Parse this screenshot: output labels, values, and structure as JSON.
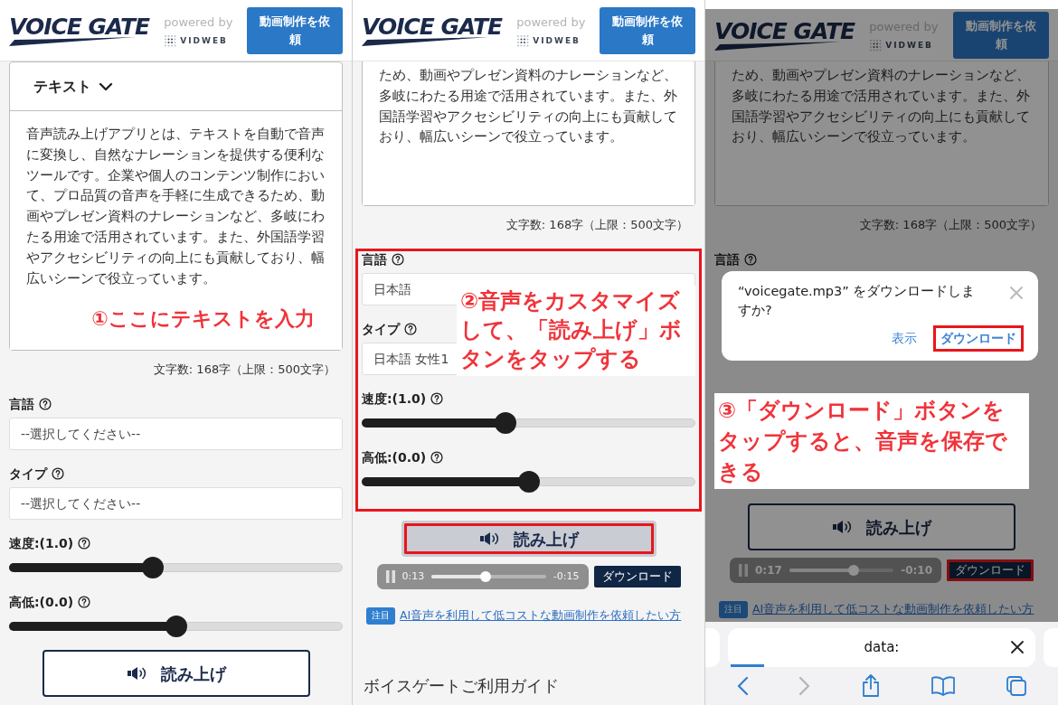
{
  "panels": [
    {
      "dimmed": false,
      "header": {
        "logo": "VOICE GATE",
        "powered_by": "powered by",
        "partner": "VIDWEB",
        "request_button": "動画制作を依頼"
      },
      "text_section": {
        "title": "テキスト",
        "text": "音声読み上げアプリとは、テキストを自動で音声に変換し、自然なナレーションを提供する便利なツールです。企業や個人のコンテンツ制作において、プロ品質の音声を手軽に生成できるため、動画やプレゼン資料のナレーションなど、多岐にわたる用途で活用されています。また、外国語学習やアクセシビリティの向上にも貢献しており、幅広いシーンで役立っています。",
        "callout": "①ここにテキストを入力"
      },
      "char_count": "文字数: 168字（上限：500文字）",
      "settings": {
        "highlighted": false,
        "fields": [
          {
            "label": "言語",
            "value": "--選択してください--"
          },
          {
            "label": "タイプ",
            "value": "--選択してください--"
          }
        ],
        "sliders": [
          {
            "label": "速度:(1.0)",
            "level": 0.43
          },
          {
            "label": "高低:(0.0)",
            "level": 0.5
          }
        ]
      },
      "read_button": {
        "label": "読み上げ",
        "pressed": false,
        "highlighted": false
      }
    },
    {
      "dimmed": false,
      "header": {
        "logo": "VOICE GATE",
        "powered_by": "powered by",
        "partner": "VIDWEB",
        "request_button": "動画制作を依頼"
      },
      "text_section": {
        "text": "ため、動画やプレゼン資料のナレーションなど、多岐にわたる用途で活用されています。また、外国語学習やアクセシビリティの向上にも貢献しており、幅広いシーンで役立っています。"
      },
      "char_count": "文字数: 168字（上限：500文字）",
      "settings": {
        "highlighted": true,
        "callout": "②音声をカスタマイズして、「読み上げ」ボタンをタップする",
        "fields": [
          {
            "label": "言語",
            "value": "日本語"
          },
          {
            "label": "タイプ",
            "value": "日本語 女性1"
          }
        ],
        "sliders": [
          {
            "label": "速度:(1.0)",
            "level": 0.43
          },
          {
            "label": "高低:(0.0)",
            "level": 0.5
          }
        ]
      },
      "read_button": {
        "label": "読み上げ",
        "pressed": true,
        "highlighted": true
      },
      "player": {
        "elapsed": "0:13",
        "remaining": "-0:15",
        "level": 0.47
      },
      "download_button": {
        "label": "ダウンロード",
        "highlighted": false
      },
      "note": {
        "badge": "注目",
        "link": "AI音声を利用して低コストな動画制作を依頼したい方"
      },
      "guide_heading": "ボイスゲートご利用ガイド"
    },
    {
      "dimmed": true,
      "header": {
        "logo": "VOICE GATE",
        "powered_by": "powered by",
        "partner": "VIDWEB",
        "request_button": "動画制作を依頼"
      },
      "text_section": {
        "text": "ため、動画やプレゼン資料のナレーションなど、多岐にわたる用途で活用されています。また、外国語学習やアクセシビリティの向上にも貢献しており、幅広いシーンで役立っています。"
      },
      "char_count": "文字数: 168字（上限：500文字）",
      "settings": {
        "highlighted": false,
        "fields": [
          {
            "label": "言語"
          }
        ]
      },
      "dialog": {
        "message": "“voicegate.mp3” をダウンロードしますか?",
        "buttons": [
          {
            "label": "表示",
            "highlighted": false
          },
          {
            "label": "ダウンロード",
            "highlighted": true
          }
        ]
      },
      "callout": "③「ダウンロード」ボタンをタップすると、音声を保存できる",
      "read_button": {
        "label": "読み上げ",
        "pressed": false,
        "highlighted": false
      },
      "player": {
        "elapsed": "0:17",
        "remaining": "-0:10",
        "level": 0.62
      },
      "download_button": {
        "label": "ダウンロード",
        "highlighted": true
      },
      "note": {
        "badge": "注目",
        "link": "AI音声を利用して低コストな動画制作を依頼したい方"
      },
      "browser_bar": {
        "url": "data:",
        "level": 0.11,
        "toolbar": [
          {
            "kind": "back",
            "disabled": false
          },
          {
            "kind": "forward",
            "disabled": true
          },
          {
            "kind": "share",
            "disabled": false
          },
          {
            "kind": "bookmarks",
            "disabled": false
          },
          {
            "kind": "tabs",
            "disabled": false
          }
        ]
      }
    }
  ]
}
